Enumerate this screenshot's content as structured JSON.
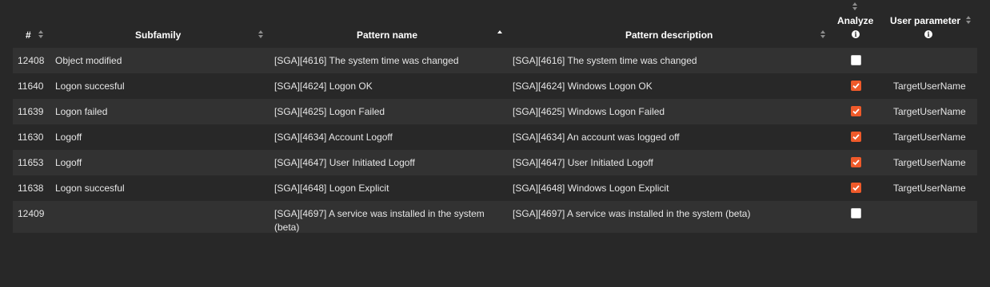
{
  "table": {
    "headers": {
      "id": "#",
      "subfamily": "Subfamily",
      "pattern_name": "Pattern name",
      "pattern_description": "Pattern description",
      "analyze": "Analyze",
      "user_parameter": "User parameter"
    },
    "sort": {
      "column": "pattern_name",
      "direction": "ascending"
    },
    "rows": [
      {
        "id": "12408",
        "subfamily": "Object modified",
        "pattern_name": "[SGA][4616] The system time was changed",
        "pattern_description": "[SGA][4616] The system time was changed",
        "analyze": false,
        "user_parameter": ""
      },
      {
        "id": "11640",
        "subfamily": "Logon succesful",
        "pattern_name": "[SGA][4624] Logon OK",
        "pattern_description": "[SGA][4624] Windows Logon OK",
        "analyze": true,
        "user_parameter": "TargetUserName"
      },
      {
        "id": "11639",
        "subfamily": "Logon failed",
        "pattern_name": "[SGA][4625] Logon Failed",
        "pattern_description": "[SGA][4625] Windows Logon Failed",
        "analyze": true,
        "user_parameter": "TargetUserName"
      },
      {
        "id": "11630",
        "subfamily": "Logoff",
        "pattern_name": "[SGA][4634] Account Logoff",
        "pattern_description": "[SGA][4634] An account was logged off",
        "analyze": true,
        "user_parameter": "TargetUserName"
      },
      {
        "id": "11653",
        "subfamily": "Logoff",
        "pattern_name": "[SGA][4647] User Initiated Logoff",
        "pattern_description": "[SGA][4647] User Initiated Logoff",
        "analyze": true,
        "user_parameter": "TargetUserName"
      },
      {
        "id": "11638",
        "subfamily": "Logon succesful",
        "pattern_name": "[SGA][4648] Logon Explicit",
        "pattern_description": "[SGA][4648] Windows Logon Explicit",
        "analyze": true,
        "user_parameter": "TargetUserName"
      },
      {
        "id": "12409",
        "subfamily": "",
        "pattern_name": "[SGA][4697] A service was installed in the system (beta)",
        "pattern_description": "[SGA][4697] A service was installed in the system (beta)",
        "analyze": false,
        "user_parameter": ""
      }
    ]
  },
  "colors": {
    "background": "#282828",
    "row_stripe": "#323232",
    "checkbox_checked": "#ef5a2a",
    "text": "#e6e6e6"
  },
  "icons": {
    "sort": "sort-arrows-icon",
    "info": "info-circle-icon",
    "check": "checkmark-icon"
  }
}
